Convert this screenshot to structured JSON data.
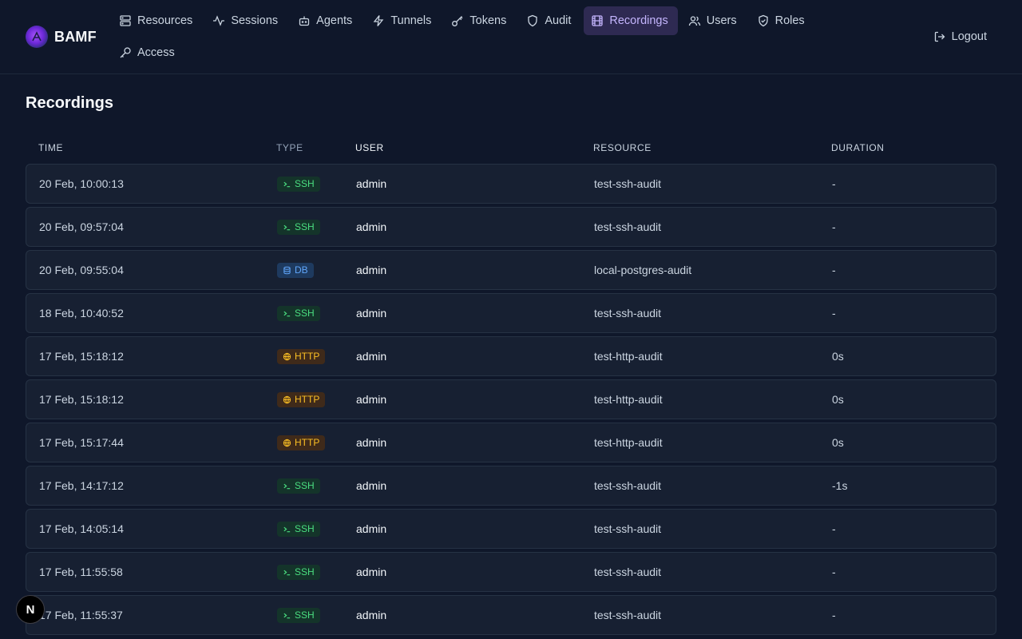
{
  "brand": {
    "name": "BAMF"
  },
  "nav": {
    "items": [
      {
        "label": "Resources",
        "icon": "server-icon"
      },
      {
        "label": "Sessions",
        "icon": "activity-icon"
      },
      {
        "label": "Agents",
        "icon": "bot-icon"
      },
      {
        "label": "Tunnels",
        "icon": "zap-icon"
      },
      {
        "label": "Tokens",
        "icon": "key-icon"
      },
      {
        "label": "Audit",
        "icon": "shield-icon"
      },
      {
        "label": "Recordings",
        "icon": "film-icon",
        "active": true
      },
      {
        "label": "Users",
        "icon": "users-icon"
      },
      {
        "label": "Roles",
        "icon": "shield-check-icon"
      },
      {
        "label": "Access",
        "icon": "key-round-icon"
      }
    ],
    "logout_label": "Logout"
  },
  "page": {
    "title": "Recordings"
  },
  "table": {
    "headers": {
      "time": "TIME",
      "type": "TYPE",
      "user": "USER",
      "resource": "RESOURCE",
      "duration": "DURATION"
    },
    "rows": [
      {
        "time": "20 Feb, 10:00:13",
        "type": "SSH",
        "user": "admin",
        "resource": "test-ssh-audit",
        "duration": "-"
      },
      {
        "time": "20 Feb, 09:57:04",
        "type": "SSH",
        "user": "admin",
        "resource": "test-ssh-audit",
        "duration": "-"
      },
      {
        "time": "20 Feb, 09:55:04",
        "type": "DB",
        "user": "admin",
        "resource": "local-postgres-audit",
        "duration": "-"
      },
      {
        "time": "18 Feb, 10:40:52",
        "type": "SSH",
        "user": "admin",
        "resource": "test-ssh-audit",
        "duration": "-"
      },
      {
        "time": "17 Feb, 15:18:12",
        "type": "HTTP",
        "user": "admin",
        "resource": "test-http-audit",
        "duration": "0s"
      },
      {
        "time": "17 Feb, 15:18:12",
        "type": "HTTP",
        "user": "admin",
        "resource": "test-http-audit",
        "duration": "0s"
      },
      {
        "time": "17 Feb, 15:17:44",
        "type": "HTTP",
        "user": "admin",
        "resource": "test-http-audit",
        "duration": "0s"
      },
      {
        "time": "17 Feb, 14:17:12",
        "type": "SSH",
        "user": "admin",
        "resource": "test-ssh-audit",
        "duration": "-1s"
      },
      {
        "time": "17 Feb, 14:05:14",
        "type": "SSH",
        "user": "admin",
        "resource": "test-ssh-audit",
        "duration": "-"
      },
      {
        "time": "17 Feb, 11:55:58",
        "type": "SSH",
        "user": "admin",
        "resource": "test-ssh-audit",
        "duration": "-"
      },
      {
        "time": "17 Feb, 11:55:37",
        "type": "SSH",
        "user": "admin",
        "resource": "test-ssh-audit",
        "duration": "-"
      }
    ]
  },
  "dev_badge": {
    "label": "N"
  },
  "colors": {
    "accent": "#c4b5fd",
    "accent_bg": "#2e2a52",
    "ssh": "#4ade80",
    "db": "#60a5fa",
    "http": "#fbbf24"
  }
}
